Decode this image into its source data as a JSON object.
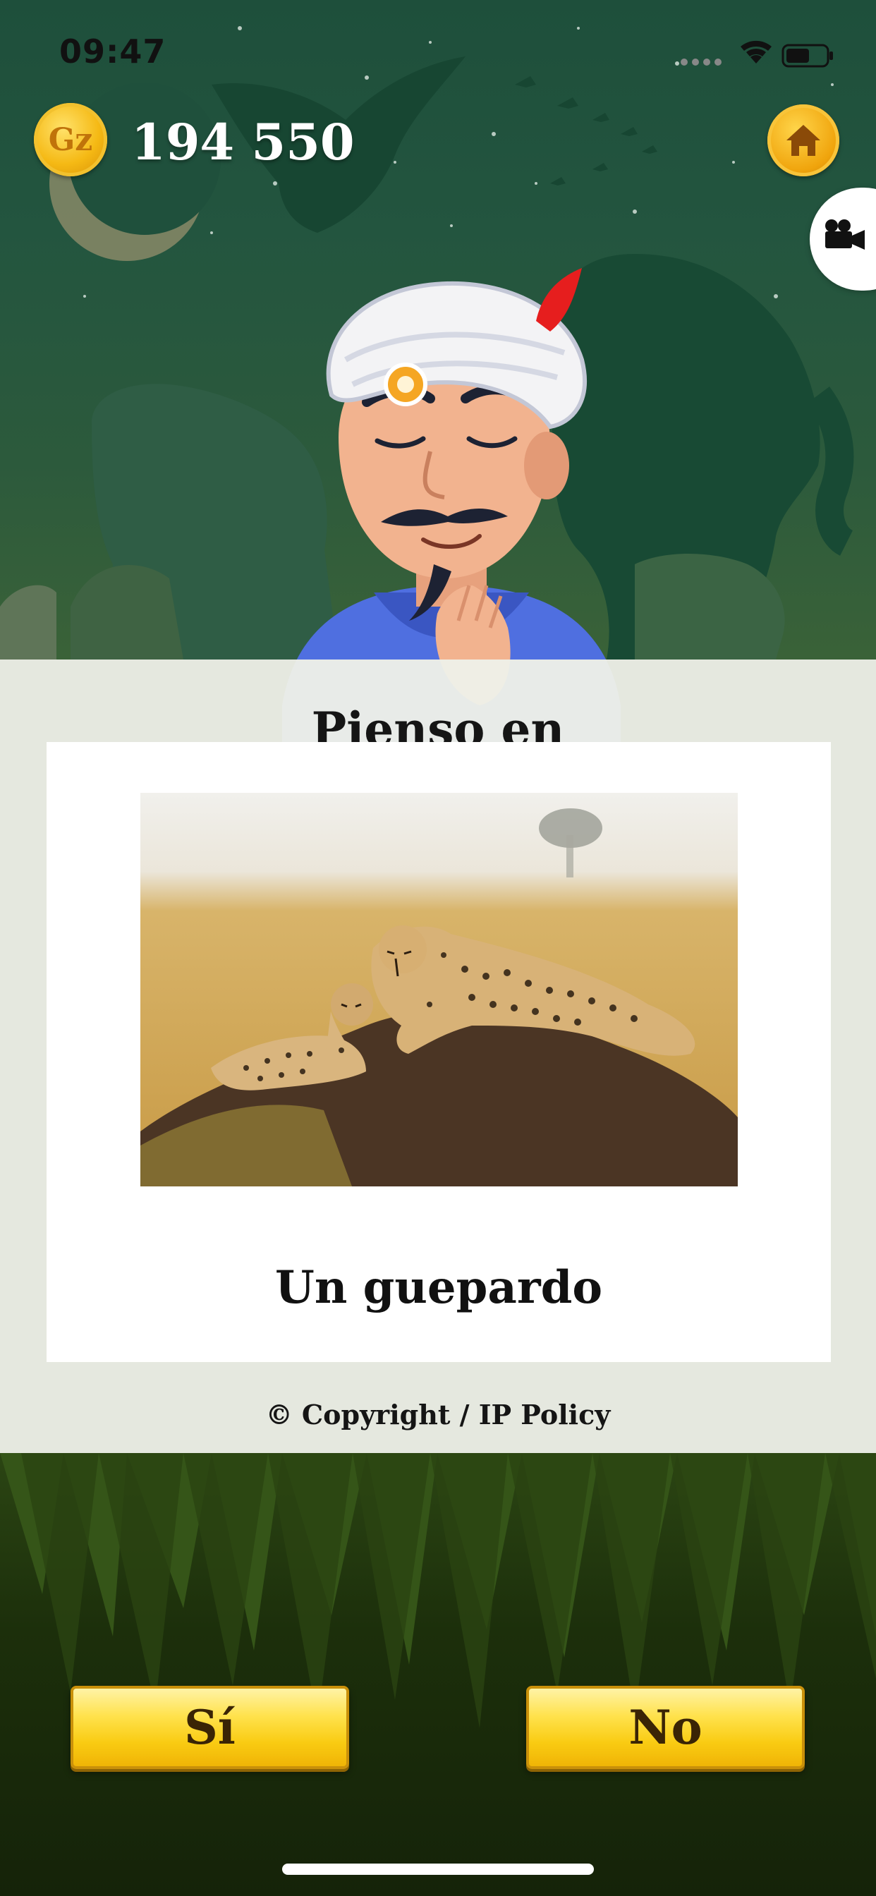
{
  "status_bar": {
    "time": "09:47"
  },
  "header": {
    "coin_symbol": "Gz",
    "coin_balance": "194 550",
    "home_icon": "home-icon",
    "video_icon": "video-camera-icon"
  },
  "panel": {
    "title": "Pienso en",
    "answer": "Un guepardo",
    "copyright": "© Copyright / IP Policy"
  },
  "buttons": {
    "yes_label": "Sí",
    "no_label": "No"
  },
  "colors": {
    "button_yellow": "#f9cb12",
    "forest_green": "#23553f",
    "grass_dark": "#152309",
    "coin_gold": "#f5b914"
  }
}
